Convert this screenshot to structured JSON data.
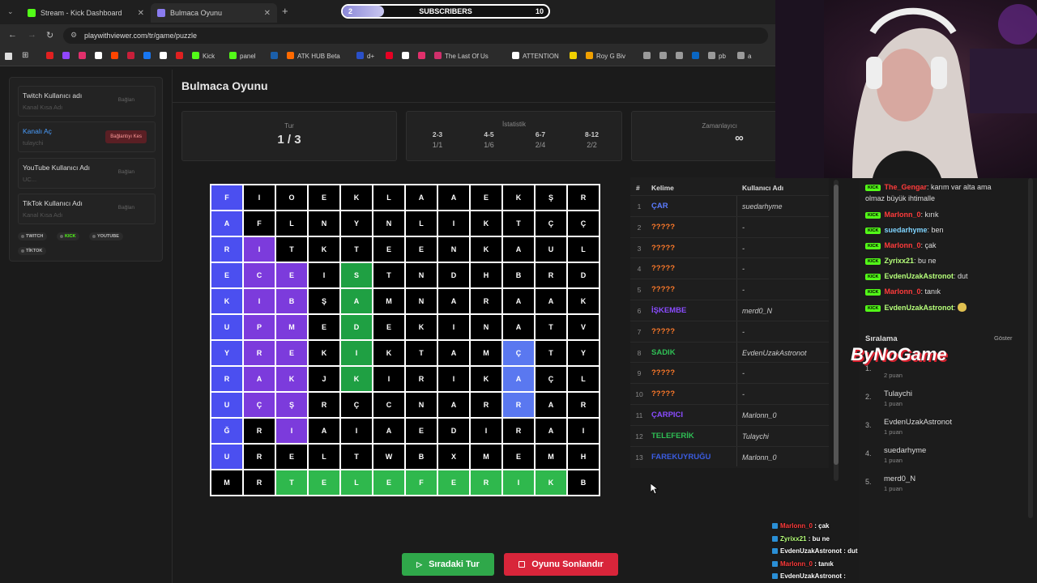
{
  "browser": {
    "tabs": [
      {
        "label": "Stream - Kick Dashboard",
        "fav_color": "#53fc18"
      },
      {
        "label": "Bulmaca Oyunu",
        "fav_color": "#8a7cf0"
      }
    ],
    "new_tab": "+",
    "url": "playwithviewer.com/tr/game/puzzle",
    "bookmarks": [
      {
        "label": "",
        "color": "#e02020"
      },
      {
        "label": "",
        "color": "#9146ff"
      },
      {
        "label": "",
        "color": "#e1306c"
      },
      {
        "label": "",
        "color": "#ffffff"
      },
      {
        "label": "",
        "color": "#ff4500"
      },
      {
        "label": "",
        "color": "#c81f3a"
      },
      {
        "label": "",
        "color": "#1877f2"
      },
      {
        "label": "",
        "color": "#ffffff"
      },
      {
        "label": "",
        "color": "#e02020"
      },
      {
        "label": "Kick",
        "color": "#53fc18"
      },
      {
        "label": "panel",
        "color": "#53fc18"
      },
      {
        "label": "",
        "color": "#1b5faa"
      },
      {
        "label": "ATK HUB Beta",
        "color": "#ff6a00"
      },
      {
        "label": "d+",
        "color": "#2a50c8"
      },
      {
        "label": "",
        "color": "#e60023"
      },
      {
        "label": "",
        "color": "#ffffff"
      },
      {
        "label": "",
        "color": "#e1306c"
      },
      {
        "label": "The Last Of Us",
        "color": "#d0306c"
      },
      {
        "label": "ATTENTION",
        "color": "#ffffff"
      },
      {
        "label": "",
        "color": "#f0d000"
      },
      {
        "label": "Roy G Biv",
        "color": "#f0a000"
      },
      {
        "label": "",
        "color": "#9a9a9a"
      },
      {
        "label": "",
        "color": "#9a9a9a"
      },
      {
        "label": "",
        "color": "#9a9a9a"
      },
      {
        "label": "",
        "color": "#0a66c2"
      },
      {
        "label": "pb",
        "color": "#9a9a9a"
      },
      {
        "label": "a",
        "color": "#9a9a9a"
      }
    ]
  },
  "subscribers": {
    "current": "2",
    "label": "SUBSCRIBERS",
    "goal": "10",
    "progress": 0.2
  },
  "accounts": [
    {
      "title": "Twitch Kullanıcı adı",
      "sub": "Kanal Kısa Adı",
      "button": "Bağlan",
      "active": false
    },
    {
      "title": "Kanalı Aç",
      "sub": "tulaychi",
      "button": "Bağlantıyı Kes",
      "active": true
    },
    {
      "title": "YouTube Kullanıcı Adı",
      "sub": "UC...",
      "button": "Bağlan",
      "active": false
    },
    {
      "title": "TikTok Kullanıcı Adı",
      "sub": "Kanal Kısa Adı",
      "button": "Bağlan",
      "active": false
    }
  ],
  "platform_chips": [
    "TWITCH",
    "KICK",
    "YOUTUBE",
    "TİKTOK"
  ],
  "page_title": "Bulmaca Oyunu",
  "stats": {
    "round_label": "Tur",
    "round_value": "1 / 3",
    "stats_label": "İstatistik",
    "groups": [
      {
        "range": "2-3",
        "value": "1/1"
      },
      {
        "range": "4-5",
        "value": "1/6"
      },
      {
        "range": "6-7",
        "value": "2/4"
      },
      {
        "range": "8-12",
        "value": "2/2"
      }
    ],
    "timer_label": "Zamanlayıcı",
    "timer_value": "∞"
  },
  "grid": [
    [
      "F",
      "I",
      "O",
      "E",
      "K",
      "L",
      "A",
      "A",
      "E",
      "K",
      "Ş",
      "R"
    ],
    [
      "A",
      "F",
      "L",
      "N",
      "Y",
      "N",
      "L",
      "I",
      "K",
      "T",
      "Ç",
      "Ç"
    ],
    [
      "R",
      "I",
      "T",
      "K",
      "T",
      "E",
      "E",
      "N",
      "K",
      "A",
      "U",
      "L"
    ],
    [
      "E",
      "C",
      "E",
      "I",
      "S",
      "T",
      "N",
      "D",
      "H",
      "B",
      "R",
      "D"
    ],
    [
      "K",
      "I",
      "B",
      "Ş",
      "A",
      "M",
      "N",
      "A",
      "R",
      "A",
      "A",
      "K"
    ],
    [
      "U",
      "P",
      "M",
      "E",
      "D",
      "E",
      "K",
      "I",
      "N",
      "A",
      "T",
      "V"
    ],
    [
      "Y",
      "R",
      "E",
      "K",
      "I",
      "K",
      "T",
      "A",
      "M",
      "Ç",
      "T",
      "Y"
    ],
    [
      "R",
      "A",
      "K",
      "J",
      "K",
      "I",
      "R",
      "I",
      "K",
      "A",
      "Ç",
      "L"
    ],
    [
      "U",
      "Ç",
      "Ş",
      "R",
      "Ç",
      "C",
      "N",
      "A",
      "R",
      "R",
      "A",
      "R"
    ],
    [
      "Ğ",
      "R",
      "I",
      "A",
      "I",
      "A",
      "E",
      "D",
      "I",
      "R",
      "A",
      "I"
    ],
    [
      "U",
      "R",
      "E",
      "L",
      "T",
      "W",
      "B",
      "X",
      "M",
      "E",
      "M",
      "H"
    ],
    [
      "M",
      "R",
      "T",
      "E",
      "L",
      "E",
      "F",
      "E",
      "R",
      "I",
      "K",
      "B"
    ]
  ],
  "grid_colors": [
    [
      "blue",
      "",
      "",
      "",
      "",
      "",
      "",
      "",
      "",
      "",
      "",
      ""
    ],
    [
      "blue",
      "",
      "",
      "",
      "",
      "",
      "",
      "",
      "",
      "",
      "",
      ""
    ],
    [
      "blue",
      "purple",
      "",
      "",
      "",
      "",
      "",
      "",
      "",
      "",
      "",
      ""
    ],
    [
      "blue",
      "purple",
      "purple",
      "",
      "green",
      "",
      "",
      "",
      "",
      "",
      "",
      ""
    ],
    [
      "blue",
      "purple",
      "purple",
      "",
      "green",
      "",
      "",
      "",
      "",
      "",
      "",
      ""
    ],
    [
      "blue",
      "purple",
      "purple",
      "",
      "green",
      "",
      "",
      "",
      "",
      "",
      "",
      ""
    ],
    [
      "blue",
      "purple",
      "purple",
      "",
      "green",
      "",
      "",
      "",
      "",
      "sky",
      "",
      ""
    ],
    [
      "blue",
      "purple",
      "purple",
      "",
      "green",
      "",
      "",
      "",
      "",
      "sky",
      "",
      ""
    ],
    [
      "blue",
      "purple",
      "purple",
      "",
      "",
      "",
      "",
      "",
      "",
      "sky",
      "",
      ""
    ],
    [
      "blue",
      "",
      "purple",
      "",
      "",
      "",
      "",
      "",
      "",
      "",
      "",
      ""
    ],
    [
      "blue",
      "",
      "",
      "",
      "",
      "",
      "",
      "",
      "",
      "",
      "",
      ""
    ],
    [
      "",
      "",
      "green2",
      "green2",
      "green2",
      "green2",
      "green2",
      "green2",
      "green2",
      "green2",
      "green2",
      ""
    ]
  ],
  "words_table": {
    "h_num": "#",
    "h_word": "Kelime",
    "h_user": "Kullanıcı Adı",
    "rows": [
      {
        "n": "1",
        "word": "ÇAR",
        "user": "suedarhyme",
        "color": "#5b7cff"
      },
      {
        "n": "2",
        "word": "?????",
        "user": "-",
        "color": "#ff7a2a"
      },
      {
        "n": "3",
        "word": "?????",
        "user": "-",
        "color": "#ff7a2a"
      },
      {
        "n": "4",
        "word": "?????",
        "user": "-",
        "color": "#ff7a2a"
      },
      {
        "n": "5",
        "word": "?????",
        "user": "-",
        "color": "#ff7a2a"
      },
      {
        "n": "6",
        "word": "İŞKEMBE",
        "user": "merd0_N",
        "color": "#8a4cff"
      },
      {
        "n": "7",
        "word": "?????",
        "user": "-",
        "color": "#ff7a2a"
      },
      {
        "n": "8",
        "word": "SADIK",
        "user": "EvdenUzakAstronot",
        "color": "#2fbf55"
      },
      {
        "n": "9",
        "word": "?????",
        "user": "-",
        "color": "#ff7a2a"
      },
      {
        "n": "10",
        "word": "?????",
        "user": "-",
        "color": "#ff7a2a"
      },
      {
        "n": "11",
        "word": "ÇARPICI",
        "user": "Marlonn_0",
        "color": "#8a4cff"
      },
      {
        "n": "12",
        "word": "TELEFERİK",
        "user": "Tulaychi",
        "color": "#2fbf55"
      },
      {
        "n": "13",
        "word": "FAREKUYRUĞU",
        "user": "Marlonn_0",
        "color": "#3b5ce0"
      }
    ]
  },
  "buttons": {
    "next": "Sıradaki Tur",
    "end": "Oyunu Sonlandır"
  },
  "chat": {
    "messages": [
      {
        "user": "The_Gengar",
        "text": "karım var alta ama",
        "color": "#ff3b3b"
      },
      {
        "user": "",
        "text": "olmaz büyük ihtimalle",
        "color": "#ddd"
      },
      {
        "user": "Marlonn_0",
        "text": "kırık",
        "color": "#ff3b3b"
      },
      {
        "user": "suedarhyme",
        "text": "ben",
        "color": "#7fd4ff"
      },
      {
        "user": "Marlonn_0",
        "text": "çak",
        "color": "#ff3b3b"
      },
      {
        "user": "Zyrixx21",
        "text": "bu ne",
        "color": "#b6ff7a"
      },
      {
        "user": "EvdenUzakAstronot",
        "text": "dut",
        "color": "#b6ff7a"
      },
      {
        "user": "Marlonn_0",
        "text": "tanık",
        "color": "#ff3b3b"
      },
      {
        "user": "EvdenUzakAstronot",
        "text": "",
        "color": "#b6ff7a"
      }
    ],
    "ranking_title": "Sıralama",
    "ranking_toggle": "Göster",
    "logo_text": "ByNoGame",
    "ranking": [
      {
        "n": "1.",
        "name": "",
        "points": "2 puan"
      },
      {
        "n": "2.",
        "name": "Tulaychi",
        "points": "1 puan"
      },
      {
        "n": "3.",
        "name": "EvdenUzakAstronot",
        "points": "1 puan"
      },
      {
        "n": "4.",
        "name": "suedarhyme",
        "points": "1 puan"
      },
      {
        "n": "5.",
        "name": "merd0_N",
        "points": "1 puan"
      }
    ]
  },
  "overlay_chat": [
    {
      "user": "Marlonn_0",
      "text": ": çak",
      "color": "#ff3b3b"
    },
    {
      "user": "Zyrixx21",
      "text": ": bu ne",
      "color": "#b6ff7a"
    },
    {
      "user": "EvdenUzakAstronot",
      "text": ": dut",
      "color": "#ffffff"
    },
    {
      "user": "Marlonn_0",
      "text": ": tanık",
      "color": "#ff3b3b"
    },
    {
      "user": "EvdenUzakAstronot",
      "text": ":",
      "color": "#ffffff"
    }
  ]
}
